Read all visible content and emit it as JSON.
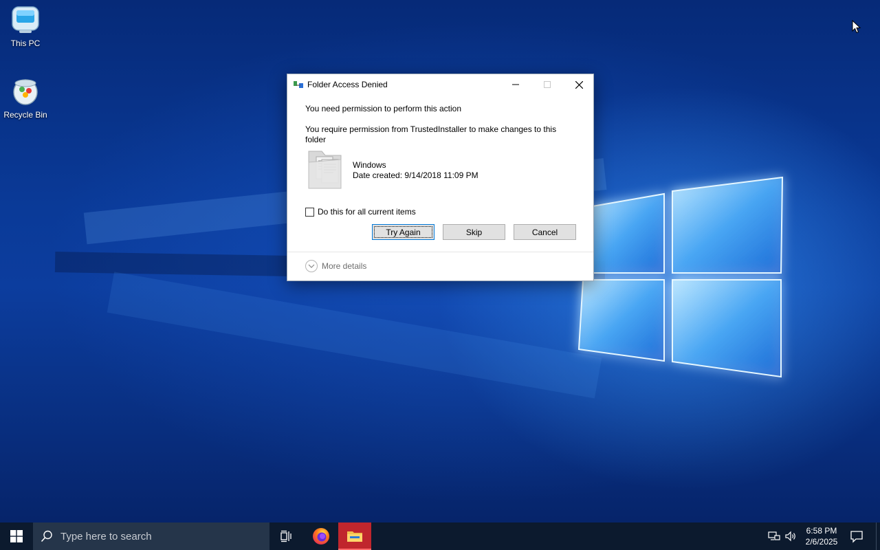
{
  "desktop": {
    "icons": [
      {
        "label": "This PC",
        "icon": "this-pc-icon"
      },
      {
        "label": "Recycle Bin",
        "icon": "recycle-bin-icon"
      }
    ]
  },
  "dialog": {
    "title": "Folder Access Denied",
    "message_main": "You need permission to perform this action",
    "message_detail": "You require permission from TrustedInstaller to make changes to this folder",
    "item": {
      "name": "Windows",
      "date_label": "Date created:",
      "date_value": "9/14/2018 11:09 PM"
    },
    "checkbox_label": "Do this for all current items",
    "checkbox_checked": false,
    "buttons": {
      "try_again": "Try Again",
      "skip": "Skip",
      "cancel": "Cancel"
    },
    "more_details": "More details"
  },
  "taskbar": {
    "search_placeholder": "Type here to search",
    "apps": [
      "task-view-icon",
      "firefox-icon",
      "file-explorer-icon"
    ],
    "clock": {
      "time": "6:58 PM",
      "date": "2/6/2025"
    }
  },
  "colors": {
    "taskbar_bg": "#0c1a2e",
    "search_bg": "#25354a",
    "active_app": "#c0262d",
    "accent": "#0078d7"
  }
}
